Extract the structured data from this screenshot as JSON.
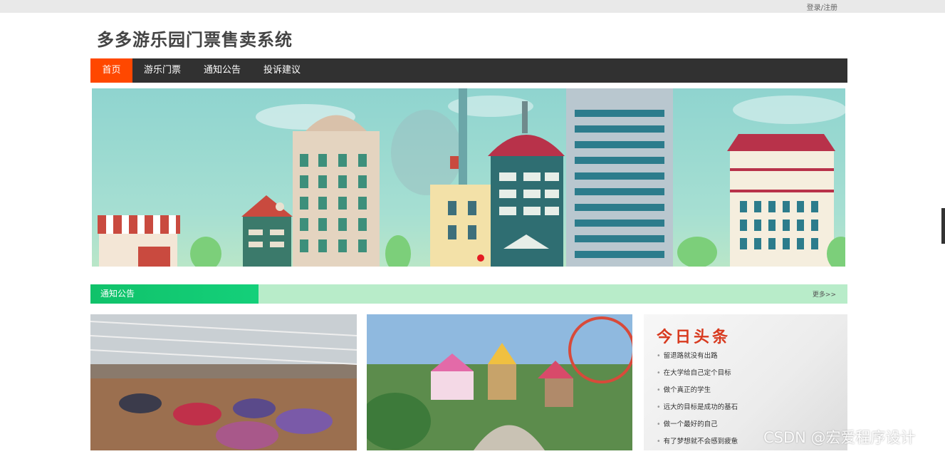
{
  "topbar": {
    "login_label": "登录/注册"
  },
  "site": {
    "title": "多多游乐园门票售卖系统"
  },
  "nav": {
    "items": [
      {
        "label": "首页",
        "active": true
      },
      {
        "label": "游乐门票",
        "active": false
      },
      {
        "label": "通知公告",
        "active": false
      },
      {
        "label": "投诉建议",
        "active": false
      }
    ]
  },
  "notice": {
    "label": "通知公告",
    "more": "更多>>"
  },
  "headlines": {
    "title": "今日头条",
    "items": [
      "留退路就没有出路",
      "在大学给自己定个目标",
      "做个真正的学生",
      "远大的目标是成功的基石",
      "做一个最好的自己",
      "有了梦想就不会感到疲惫"
    ]
  },
  "watermark": "CSDN @宏爱程序设计",
  "colors": {
    "nav_bg": "#313131",
    "nav_active": "#ff4800",
    "notice_green": "#10c26a",
    "notice_bar": "#b8ecc9",
    "headline_red": "#d83a1f"
  }
}
